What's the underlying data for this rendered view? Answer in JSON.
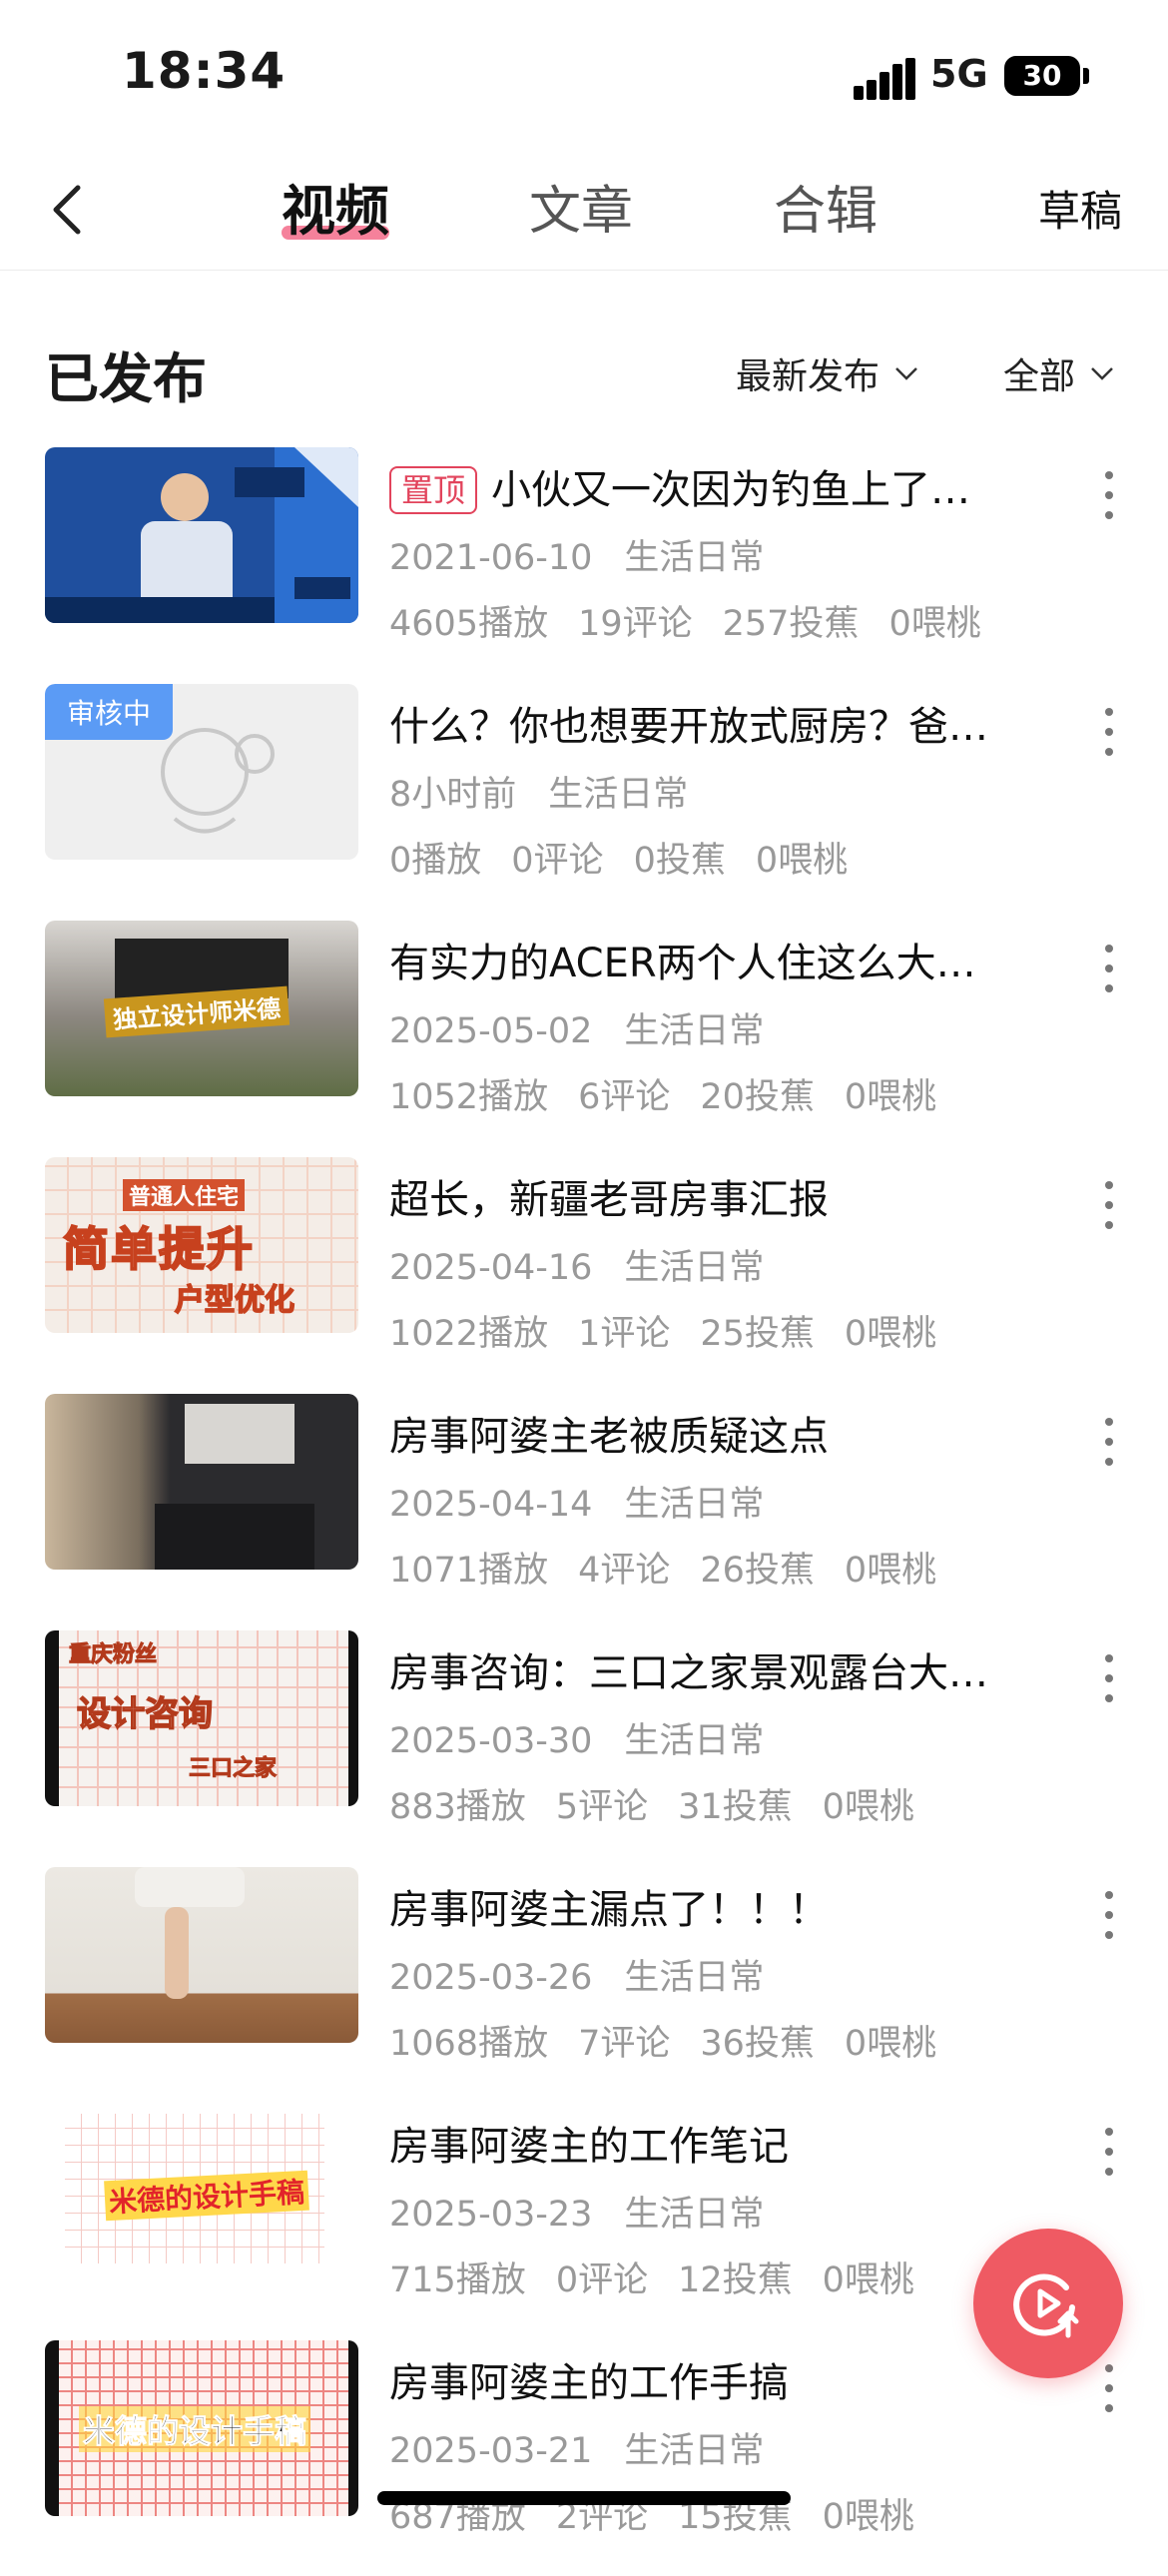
{
  "status_bar": {
    "time": "18:34",
    "network": "5G",
    "battery": "30"
  },
  "nav": {
    "tabs": [
      {
        "label": "视频"
      },
      {
        "label": "文章"
      },
      {
        "label": "合辑"
      }
    ],
    "draft_label": "草稿"
  },
  "section": {
    "title": "已发布",
    "sort_label": "最新发布",
    "filter_label": "全部"
  },
  "videos": [
    {
      "title": "小伙又一次因为钓鱼上了…",
      "pinned_label": "置顶",
      "date": "2021-06-10",
      "category": "生活日常",
      "plays": "4605播放",
      "comments": "19评论",
      "bananas": "257投蕉",
      "peaches": "0喂桃",
      "thumb_text": ""
    },
    {
      "title": "什么？你也想要开放式厨房？爸…",
      "review_label": "审核中",
      "date": "8小时前",
      "category": "生活日常",
      "plays": "0播放",
      "comments": "0评论",
      "bananas": "0投蕉",
      "peaches": "0喂桃",
      "thumb_text": ""
    },
    {
      "title": "有实力的ACER两个人住这么大…",
      "date": "2025-05-02",
      "category": "生活日常",
      "plays": "1052播放",
      "comments": "6评论",
      "bananas": "20投蕉",
      "peaches": "0喂桃",
      "thumb_text": "独立设计师米德"
    },
    {
      "title": "超长，新疆老哥房事汇报",
      "date": "2025-04-16",
      "category": "生活日常",
      "plays": "1022播放",
      "comments": "1评论",
      "bananas": "25投蕉",
      "peaches": "0喂桃",
      "thumb_text": "简单提升",
      "thumb_text2": "普通人住宅",
      "thumb_text3": "户型优化"
    },
    {
      "title": "房事阿婆主老被质疑这点",
      "date": "2025-04-14",
      "category": "生活日常",
      "plays": "1071播放",
      "comments": "4评论",
      "bananas": "26投蕉",
      "peaches": "0喂桃",
      "thumb_text": ""
    },
    {
      "title": "房事咨询：三口之家景观露台大…",
      "date": "2025-03-30",
      "category": "生活日常",
      "plays": "883播放",
      "comments": "5评论",
      "bananas": "31投蕉",
      "peaches": "0喂桃",
      "thumb_text": "设计咨询",
      "thumb_text2": "重庆粉丝",
      "thumb_text3": "三口之家"
    },
    {
      "title": "房事阿婆主漏点了！！！",
      "date": "2025-03-26",
      "category": "生活日常",
      "plays": "1068播放",
      "comments": "7评论",
      "bananas": "36投蕉",
      "peaches": "0喂桃",
      "thumb_text": ""
    },
    {
      "title": "房事阿婆主的工作笔记",
      "date": "2025-03-23",
      "category": "生活日常",
      "plays": "715播放",
      "comments": "0评论",
      "bananas": "12投蕉",
      "peaches": "0喂桃",
      "thumb_text": "米德的设计手稿"
    },
    {
      "title": "房事阿婆主的工作手搞",
      "date": "2025-03-21",
      "category": "生活日常",
      "plays": "687播放",
      "comments": "2评论",
      "bananas": "15投蕉",
      "peaches": "0喂桃",
      "thumb_text": "米德的设计手稿"
    }
  ],
  "colors": {
    "accent_pink": "#f36b8a",
    "pin_red": "#e2445c",
    "review_blue": "#5b9bf5",
    "fab_red": "#ef5a63"
  },
  "icons": {
    "back": "chevron-left-icon",
    "more": "more-vertical-icon",
    "upload": "upload-video-icon"
  }
}
